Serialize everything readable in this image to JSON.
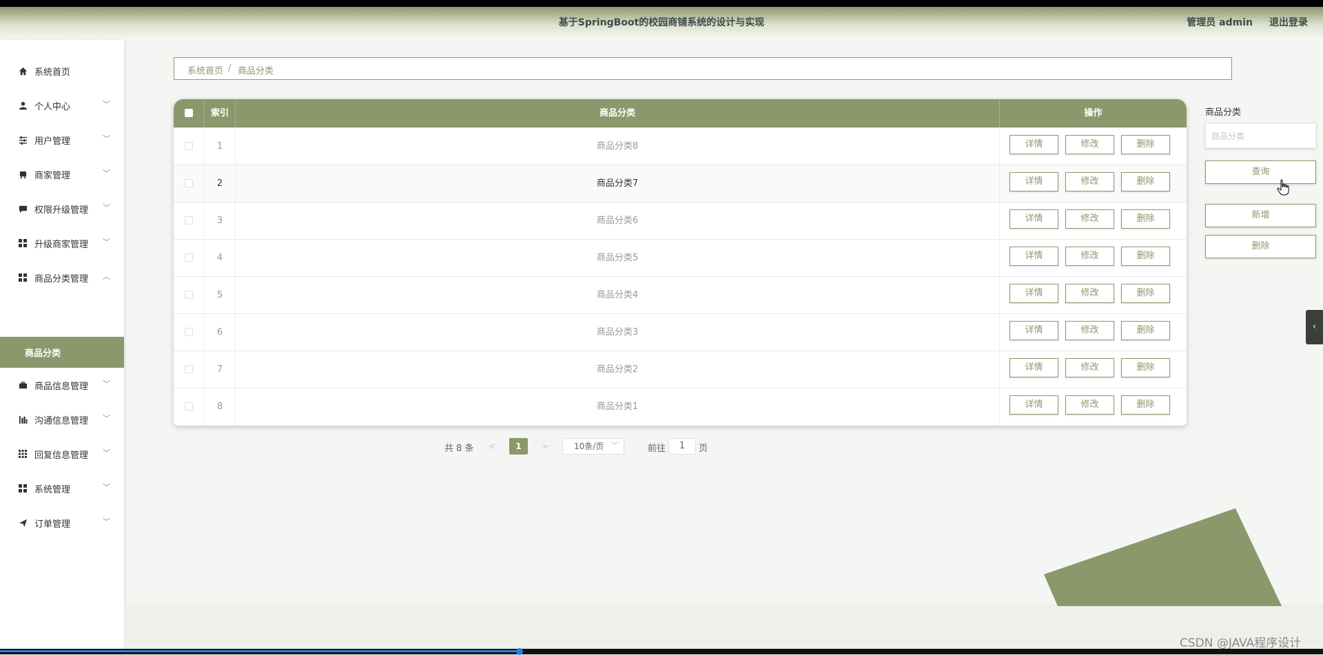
{
  "header": {
    "title": "基于SpringBoot的校园商铺系统的设计与实现",
    "user": "管理员 admin",
    "logout": "退出登录"
  },
  "sidebar": {
    "items": [
      {
        "label": "系统首页",
        "icon": "home-icon"
      },
      {
        "label": "个人中心",
        "icon": "user-icon"
      },
      {
        "label": "用户管理",
        "icon": "sliders-icon"
      },
      {
        "label": "商家管理",
        "icon": "store-icon"
      },
      {
        "label": "权限升级管理",
        "icon": "chat-icon"
      },
      {
        "label": "升级商家管理",
        "icon": "grid-icon"
      },
      {
        "label": "商品分类管理",
        "icon": "grid-icon"
      },
      {
        "label": "商品信息管理",
        "icon": "briefcase-icon"
      },
      {
        "label": "沟通信息管理",
        "icon": "chart-icon"
      },
      {
        "label": "回复信息管理",
        "icon": "dots-grid-icon"
      },
      {
        "label": "系统管理",
        "icon": "grid-icon"
      },
      {
        "label": "订单管理",
        "icon": "send-icon"
      }
    ],
    "active_sub": "商品分类"
  },
  "breadcrumb": {
    "home": "系统首页",
    "separator": "/",
    "current": "商品分类"
  },
  "table": {
    "headers": {
      "index": "索引",
      "category": "商品分类",
      "actions": "操作"
    },
    "rows": [
      {
        "index": "1",
        "name": "商品分类8"
      },
      {
        "index": "2",
        "name": "商品分类7"
      },
      {
        "index": "3",
        "name": "商品分类6"
      },
      {
        "index": "4",
        "name": "商品分类5"
      },
      {
        "index": "5",
        "name": "商品分类4"
      },
      {
        "index": "6",
        "name": "商品分类3"
      },
      {
        "index": "7",
        "name": "商品分类2"
      },
      {
        "index": "8",
        "name": "商品分类1"
      }
    ],
    "actions": {
      "detail": "详情",
      "edit": "修改",
      "delete": "删除"
    }
  },
  "pagination": {
    "total": "共 8 条",
    "prev": "<",
    "current": "1",
    "next": ">",
    "page_size": "10条/页",
    "goto": "前往",
    "goto_value": "1",
    "page_unit": "页"
  },
  "search_panel": {
    "label": "商品分类",
    "placeholder": "商品分类",
    "query_button": "查询",
    "add_button": "新增",
    "delete_button": "删除"
  },
  "side_tab": "‹",
  "watermark": "CSDN @JAVA程序设计",
  "colors": {
    "accent": "#8b986c",
    "text_dark": "#3e4c48"
  }
}
